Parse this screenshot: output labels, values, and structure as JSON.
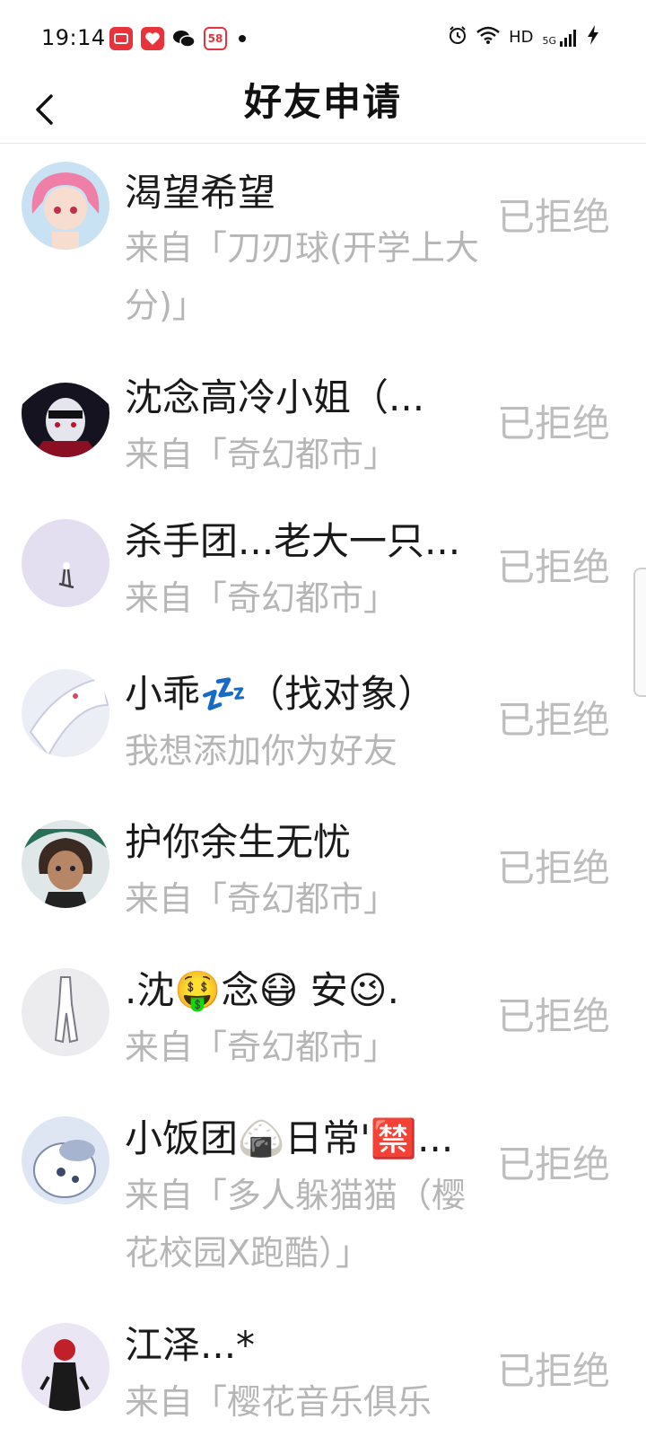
{
  "status_bar": {
    "time": "19:14",
    "app_icons": [
      "video-app-icon",
      "heart-app-icon",
      "wechat-icon",
      "58-app-icon"
    ],
    "app_badge_58": "58",
    "hd": "HD",
    "network": "5G"
  },
  "header": {
    "title": "好友申请"
  },
  "requests": [
    {
      "name": "渴望希望",
      "source": "来自「刀刃球(开学上大分)」",
      "status": "已拒绝"
    },
    {
      "name": "沈念高冷小姐（...",
      "source": "来自「奇幻都市」",
      "status": "已拒绝"
    },
    {
      "name": "杀手团...老大一只...",
      "source": "来自「奇幻都市」",
      "status": "已拒绝"
    },
    {
      "name": "小乖💤（找对象）",
      "source": "我想添加你为好友",
      "status": "已拒绝"
    },
    {
      "name": "护你余生无忧",
      "source": "来自「奇幻都市」",
      "status": "已拒绝"
    },
    {
      "name": ".沈🤑念😷 安😉.",
      "source": "来自「奇幻都市」",
      "status": "已拒绝"
    },
    {
      "name": "小饭团🍙日常'🈲...",
      "source": "来自「多人躲猫猫（樱花校园X跑酷）」",
      "status": "已拒绝"
    },
    {
      "name": "江泽...*",
      "source": "来自「樱花音乐俱乐",
      "status": "已拒绝"
    }
  ],
  "colors": {
    "secondary_text": "#b6b6b6",
    "status_text": "#bdbdbd",
    "divider": "#e6e6e6"
  }
}
